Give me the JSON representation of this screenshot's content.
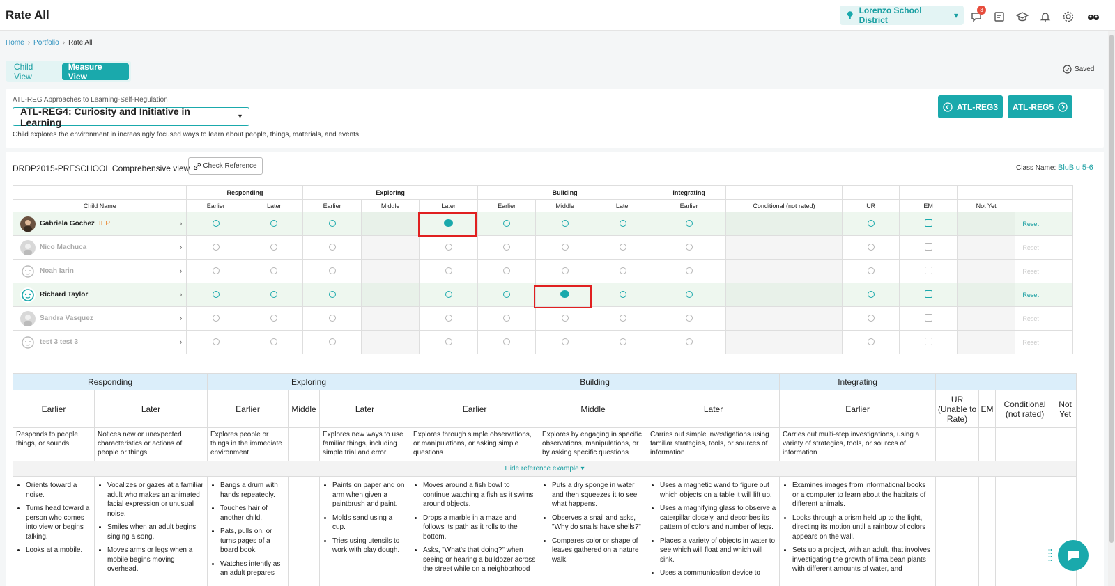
{
  "app": {
    "title": "Rate All",
    "district": "Lorenzo School District",
    "notification_count": "3"
  },
  "icons": {
    "district": "tree-icon",
    "chat": "chat-icon",
    "report": "report-icon",
    "learn": "graduation-cap-icon",
    "bell": "bell-icon",
    "settings": "gear-icon",
    "avatar": "avatar-icon"
  },
  "breadcrumb": [
    {
      "label": "Home"
    },
    {
      "label": "Portfolio"
    },
    {
      "label": "Rate All"
    }
  ],
  "view_tabs": [
    {
      "label": "Child View",
      "active": false
    },
    {
      "label": "Measure View",
      "active": true
    }
  ],
  "status": {
    "saved": "Saved"
  },
  "measure": {
    "domain": "ATL-REG Approaches to Learning-Self-Regulation",
    "selected": "ATL-REG4: Curiosity and Initiative in Learning",
    "description": "Child explores the environment in increasingly focused ways to learn about people, things, materials, and events",
    "prev": "ATL-REG3",
    "next": "ATL-REG5"
  },
  "view_bar": {
    "title": "DRDP2015-PRESCHOOL Comprehensive view",
    "check_reference": "Check Reference",
    "class_label": "Class Name:",
    "class_name": "BluBlu 5-6"
  },
  "rating_table": {
    "groups": [
      "Responding",
      "Exploring",
      "Building",
      "Integrating"
    ],
    "child_name_header": "Child Name",
    "levels": [
      "Earlier",
      "Later",
      "Earlier",
      "Middle",
      "Later",
      "Earlier",
      "Middle",
      "Later",
      "Earlier"
    ],
    "extra_headers": [
      "Conditional (not rated)",
      "UR",
      "EM",
      "Not Yet",
      ""
    ],
    "reset_label": "Reset",
    "children": [
      {
        "name": "Gabriela Gochez",
        "tag": "IEP",
        "active": true
      },
      {
        "name": "Nico Machuca",
        "tag": "",
        "active": false
      },
      {
        "name": "Noah Iarin",
        "tag": "",
        "active": false
      },
      {
        "name": "Richard Taylor",
        "tag": "",
        "active": true
      },
      {
        "name": "Sandra Vasquez",
        "tag": "",
        "active": false
      },
      {
        "name": "test 3 test 3",
        "tag": "",
        "active": false
      }
    ]
  },
  "reference": {
    "groups": [
      "Responding",
      "Exploring",
      "Building",
      "Integrating"
    ],
    "levels": [
      "Earlier",
      "Later",
      "Earlier",
      "Middle",
      "Later",
      "Earlier",
      "Middle",
      "Later",
      "Earlier"
    ],
    "extra": [
      "UR (Unable to Rate)",
      "EM",
      "Conditional (not rated)",
      "Not Yet"
    ],
    "descriptors": [
      "Responds to people, things, or sounds",
      "Notices new or unexpected characteristics or actions of people or things",
      "Explores people or things in the immediate environment",
      "",
      "Explores new ways to use familiar things, including simple trial and error",
      "Explores through simple observations, or manipulations, or asking simple questions",
      "Explores by engaging in specific observations, manipulations, or by asking specific questions",
      "Carries out simple investigations using familiar strategies, tools, or sources of information",
      "Carries out multi-step investigations, using a variety of strategies, tools, or sources of information"
    ],
    "hide_label": "Hide reference example",
    "examples": [
      [
        "Orients toward a noise.",
        "Turns head toward a person who comes into view or begins talking.",
        "Looks at a mobile."
      ],
      [
        "Vocalizes or gazes at a familiar adult who makes an animated facial expression or unusual noise.",
        "Smiles when an adult begins singing a song.",
        "Moves arms or legs when a mobile begins moving overhead."
      ],
      [
        "Bangs a drum with hands repeatedly.",
        "Touches hair of another child.",
        "Pats, pulls on, or turns pages of a board book.",
        "Watches intently as an adult prepares"
      ],
      [],
      [
        "Paints on paper and on arm when given a paintbrush and paint.",
        "Molds sand using a cup.",
        "Tries using utensils to work with play dough."
      ],
      [
        "Moves around a fish bowl to continue watching a fish as it swims around objects.",
        "Drops a marble in a maze and follows its path as it rolls to the bottom.",
        "Asks, \"What's that doing?\" when seeing or hearing a bulldozer across the street while on a neighborhood"
      ],
      [
        "Puts a dry sponge in water and then squeezes it to see what happens.",
        "Observes a snail and asks, \"Why do snails have shells?\"",
        "Compares color or shape of leaves gathered on a nature walk."
      ],
      [
        "Uses a magnetic wand to figure out which objects on a table it will lift up.",
        "Uses a magnifying glass to observe a caterpillar closely, and describes its pattern of colors and number of legs.",
        "Places a variety of objects in water to see which will float and which will sink.",
        "Uses a communication device to"
      ],
      [
        "Examines images from informational books or a computer to learn about the habitats of different animals.",
        "Looks through a prism held up to the light, directing its motion until a rainbow of colors appears on the wall.",
        "Sets up a project, with an adult, that involves investigating the growth of lima bean plants with different amounts of water, and"
      ]
    ]
  }
}
